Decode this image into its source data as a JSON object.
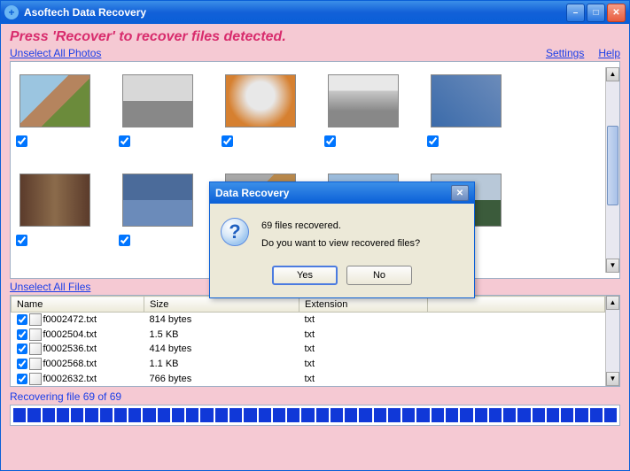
{
  "titlebar": {
    "title": "Asoftech Data Recovery",
    "icon_glyph": "+"
  },
  "instruction": "Press 'Recover' to recover files detected.",
  "links": {
    "unselect_photos": "Unselect All Photos",
    "unselect_files": "Unselect All Files",
    "settings": "Settings",
    "help": "Help"
  },
  "file_table": {
    "columns": {
      "name": "Name",
      "size": "Size",
      "extension": "Extension"
    },
    "rows": [
      {
        "name": "f0002472.txt",
        "size": "814 bytes",
        "ext": "txt",
        "checked": true
      },
      {
        "name": "f0002504.txt",
        "size": "1.5 KB",
        "ext": "txt",
        "checked": true
      },
      {
        "name": "f0002536.txt",
        "size": "414 bytes",
        "ext": "txt",
        "checked": true
      },
      {
        "name": "f0002568.txt",
        "size": "1.1 KB",
        "ext": "txt",
        "checked": true
      },
      {
        "name": "f0002632.txt",
        "size": "766 bytes",
        "ext": "txt",
        "checked": true
      }
    ]
  },
  "status": "Recovering file 69 of 69",
  "progress_segments": 42,
  "modal": {
    "title": "Data Recovery",
    "line1": "69 files recovered.",
    "line2": "Do you want to view recovered files?",
    "yes": "Yes",
    "no": "No",
    "icon_glyph": "?"
  },
  "thumbs": [
    {
      "checked": true,
      "cls": "thumb-img1"
    },
    {
      "checked": true,
      "cls": "thumb-img2"
    },
    {
      "checked": true,
      "cls": "thumb-img3"
    },
    {
      "checked": true,
      "cls": "thumb-img4"
    },
    {
      "checked": true,
      "cls": "thumb-img5"
    },
    {
      "checked": true,
      "cls": "thumb-img6"
    },
    {
      "checked": true,
      "cls": "thumb-img7"
    },
    {
      "checked": true,
      "cls": "thumb-img8"
    },
    {
      "checked": true,
      "cls": "thumb-img9"
    },
    {
      "checked": true,
      "cls": "thumb-img10"
    },
    {
      "checked": true,
      "cls": "thumb-img11"
    }
  ]
}
